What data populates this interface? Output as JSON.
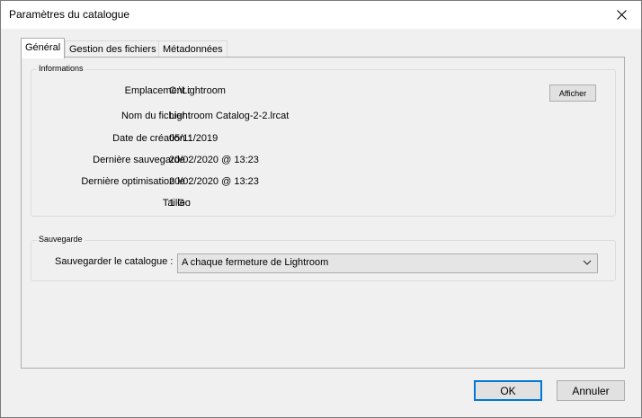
{
  "window": {
    "title": "Paramètres du catalogue"
  },
  "tabs": [
    {
      "label": "Général",
      "active": true
    },
    {
      "label": "Gestion des fichiers",
      "active": false
    },
    {
      "label": "Métadonnées",
      "active": false
    }
  ],
  "info": {
    "legend": "Informations",
    "rows": [
      {
        "label": "Emplacement :",
        "value": "C:\\Lightroom"
      },
      {
        "label": "Nom du fichier :",
        "value": "Lightroom Catalog-2-2.lrcat"
      },
      {
        "label": "Date de création :",
        "value": "05/11/2019"
      },
      {
        "label": "Dernière sauvegarde :",
        "value": "20/02/2020 @ 13:23"
      },
      {
        "label": "Dernière optimisation le :",
        "value": "20/02/2020 @ 13:23"
      },
      {
        "label": "Taille :",
        "value": "1 Go"
      }
    ],
    "show_button": "Afficher"
  },
  "backup": {
    "legend": "Sauvegarde",
    "label": "Sauvegarder le catalogue :",
    "selected": "A chaque fermeture de Lightroom"
  },
  "footer": {
    "ok": "OK",
    "cancel": "Annuler"
  },
  "colors": {
    "default_button_border": "#0078d7",
    "background": "#f0f0f0"
  },
  "icons": {
    "close": "close-icon",
    "dropdown": "chevron-down-icon"
  }
}
